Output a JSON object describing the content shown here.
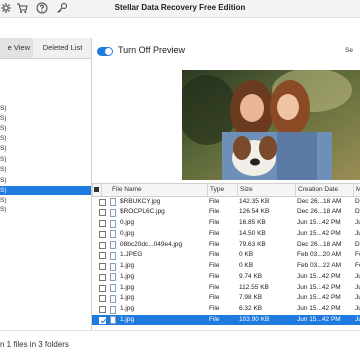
{
  "window": {
    "title": "Stellar Data Recovery Free Edition"
  },
  "toolbar": {
    "icons": [
      "settings-icon",
      "cart-icon",
      "help-icon",
      "key-icon"
    ]
  },
  "tabs": {
    "file_view": "e View",
    "deleted_list": "Deleted List"
  },
  "tree": [
    "S)",
    "S)",
    "S)",
    "S)",
    "S)",
    "S)",
    "S)",
    "S)",
    "S)",
    "S)",
    "S)"
  ],
  "tree_selected_index": 8,
  "preview": {
    "toggle_label": "Turn Off Preview",
    "toggle_on": true,
    "search_label": "Se"
  },
  "grid": {
    "headers": {
      "name": "File Name",
      "type": "Type",
      "size": "Size",
      "created": "Creation Date",
      "modified": "M"
    },
    "rows": [
      {
        "name": "$RBUKCY.jpg",
        "type": "File",
        "size": "142.35 KB",
        "created": "Dec 26...18 AM",
        "mod": "De"
      },
      {
        "name": "$ROCPL6C.jpg",
        "type": "File",
        "size": "126.54 KB",
        "created": "Dec 26...18 AM",
        "mod": "De"
      },
      {
        "name": "0.jpg",
        "type": "File",
        "size": "16.85 KB",
        "created": "Jun 15...42 PM",
        "mod": "Ju"
      },
      {
        "name": "0.jpg",
        "type": "File",
        "size": "14.50 KB",
        "created": "Jun 15...42 PM",
        "mod": "Ju"
      },
      {
        "name": "08bc20dc...049e4.jpg",
        "type": "File",
        "size": "79.63 KB",
        "created": "Dec 26...18 AM",
        "mod": "De"
      },
      {
        "name": "1.JPEG",
        "type": "File",
        "size": "0 KB",
        "created": "Feb 03...20 AM",
        "mod": "Fe"
      },
      {
        "name": "1.jpg",
        "type": "File",
        "size": "0 KB",
        "created": "Feb 03...22 AM",
        "mod": "Fe"
      },
      {
        "name": "1.jpg",
        "type": "File",
        "size": "9.74 KB",
        "created": "Jun 15...42 PM",
        "mod": "Ju"
      },
      {
        "name": "1.jpg",
        "type": "File",
        "size": "112.55 KB",
        "created": "Jun 15...42 PM",
        "mod": "Ju"
      },
      {
        "name": "1.jpg",
        "type": "File",
        "size": "7.98 KB",
        "created": "Jun 15...42 PM",
        "mod": "Ju"
      },
      {
        "name": "1.jpg",
        "type": "File",
        "size": "6.32 KB",
        "created": "Jun 15...42 PM",
        "mod": "Ju"
      },
      {
        "name": "1.jpg",
        "type": "File",
        "size": "103.90 KB",
        "created": "Jun 15...42 PM",
        "mod": "Ju"
      }
    ],
    "selected_index": 11
  },
  "status": {
    "text": "n 1 files in 3 folders"
  },
  "colors": {
    "accent": "#1f7ae0",
    "titlebar": "#f3f3f3"
  }
}
